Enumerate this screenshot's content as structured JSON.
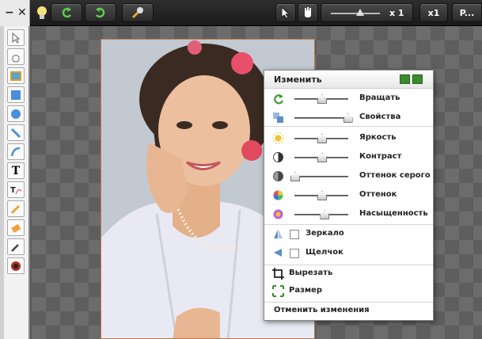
{
  "toolbar": {
    "zoom_label": "x 1",
    "zoom_level": 0.6,
    "x1_label": "x1",
    "last_label": "P..."
  },
  "panel": {
    "title": "Изменить",
    "sliders": [
      {
        "label": "Вращать",
        "value": 0.5,
        "icon": "rotate-icon"
      },
      {
        "label": "Свойства",
        "value": 0.98,
        "icon": "properties-icon"
      },
      {
        "label": "Яркость",
        "value": 0.5,
        "icon": "brightness-icon"
      },
      {
        "label": "Контраст",
        "value": 0.5,
        "icon": "contrast-icon"
      },
      {
        "label": "Оттенок серого",
        "value": 0.0,
        "icon": "grayscale-icon"
      },
      {
        "label": "Оттенок",
        "value": 0.5,
        "icon": "hue-icon"
      },
      {
        "label": "Насыщенность",
        "value": 0.55,
        "icon": "saturation-icon"
      }
    ],
    "mirror_label": "Зеркало",
    "flip_label": "Щелчок",
    "crop_label": "Вырезать",
    "resize_label": "Размер",
    "undo_label": "Отменить изменения"
  },
  "colors": {
    "accent_green": "#3b8a2e",
    "frame": "#b87a4a"
  }
}
